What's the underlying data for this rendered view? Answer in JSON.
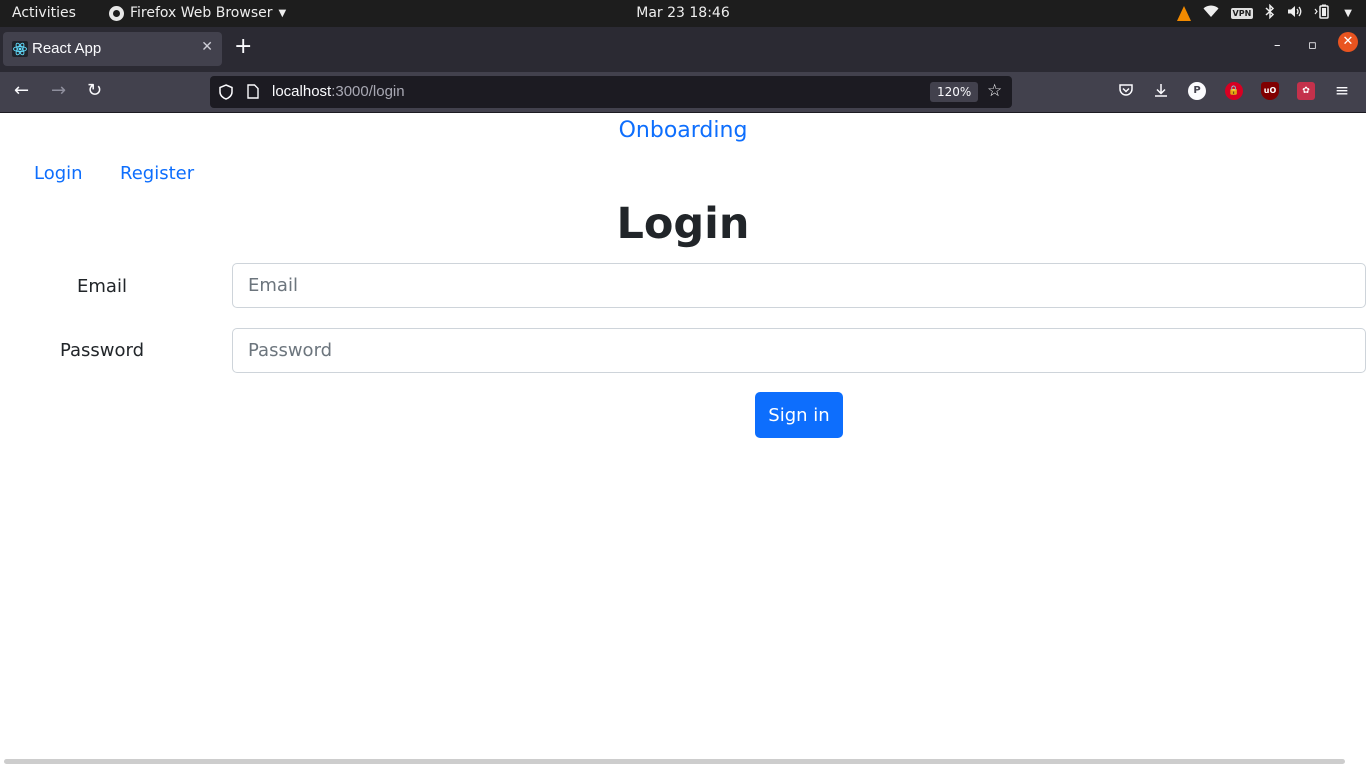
{
  "system_bar": {
    "activities": "Activities",
    "app_name": "Firefox Web Browser",
    "clock": "Mar 23  18:46",
    "vpn_label": "VPN"
  },
  "browser": {
    "tab_title": "React App",
    "url_host": "localhost",
    "url_rest": ":3000/login",
    "zoom": "120%",
    "extension_p": "P",
    "extension_ublock": "uO"
  },
  "page": {
    "brand": "Onboarding",
    "nav": {
      "login": "Login",
      "register": "Register"
    },
    "heading": "Login",
    "form": {
      "email_label": "Email",
      "email_placeholder": "Email",
      "email_value": "",
      "password_label": "Password",
      "password_placeholder": "Password",
      "password_value": "",
      "submit_label": "Sign in"
    }
  },
  "colors": {
    "link": "#0d6efd",
    "button_bg": "#0d6efd",
    "text": "#212529",
    "topbar_bg": "#1d1d1d",
    "tabstrip_bg": "#2b2a33",
    "toolbar_bg": "#42414d",
    "close_button": "#e95420"
  }
}
